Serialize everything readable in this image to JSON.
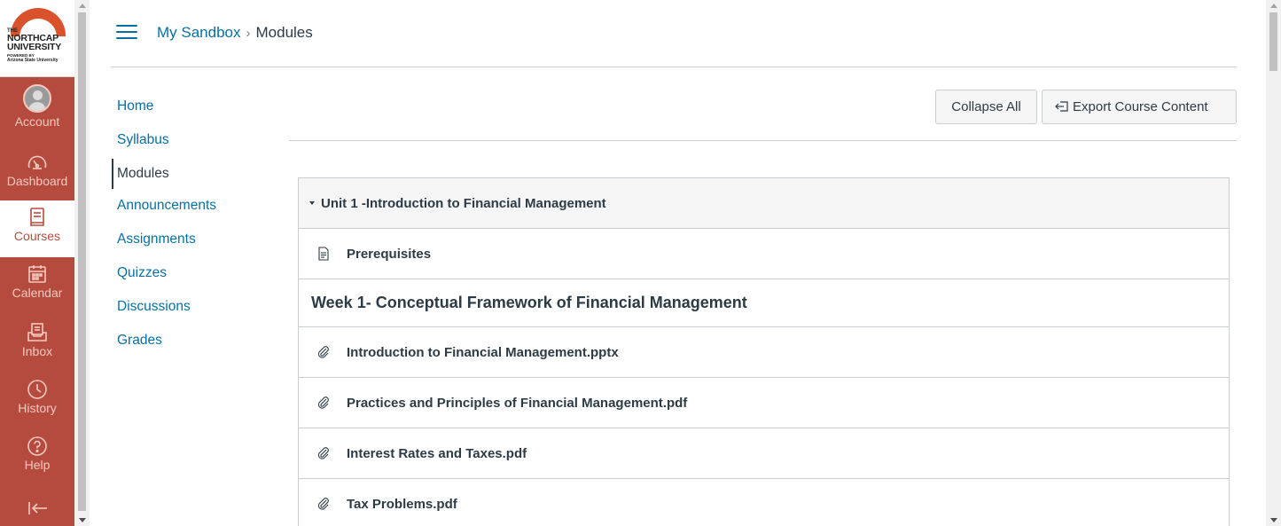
{
  "logo": {
    "line1": "THE",
    "line2": "NORTHCAP",
    "line3": "UNIVERSITY",
    "line4": "POWERED BY",
    "line5": "Arizona State University"
  },
  "global_nav": [
    {
      "label": "Account",
      "icon": "avatar-icon"
    },
    {
      "label": "Dashboard",
      "icon": "dashboard-icon"
    },
    {
      "label": "Courses",
      "icon": "courses-icon"
    },
    {
      "label": "Calendar",
      "icon": "calendar-icon"
    },
    {
      "label": "Inbox",
      "icon": "inbox-icon"
    },
    {
      "label": "History",
      "icon": "clock-icon"
    },
    {
      "label": "Help",
      "icon": "help-icon"
    }
  ],
  "breadcrumb": {
    "course": "My Sandbox",
    "separator": "›",
    "current": "Modules"
  },
  "course_nav": [
    "Home",
    "Syllabus",
    "Modules",
    "Announcements",
    "Assignments",
    "Quizzes",
    "Discussions",
    "Grades"
  ],
  "toolbar": {
    "collapse_label": "Collapse All",
    "export_label": "Export Course Content"
  },
  "module": {
    "title": "Unit 1 -Introduction to Financial Management",
    "items": [
      {
        "type": "page",
        "icon": "page-icon",
        "title": "Prerequisites"
      },
      {
        "type": "subheader",
        "title": "Week 1- Conceptual Framework of Financial Management"
      },
      {
        "type": "file",
        "icon": "paperclip-icon",
        "title": "Introduction to Financial Management.pptx"
      },
      {
        "type": "file",
        "icon": "paperclip-icon",
        "title": "Practices and Principles of Financial Management.pdf"
      },
      {
        "type": "file",
        "icon": "paperclip-icon",
        "title": "Interest Rates and Taxes.pdf"
      },
      {
        "type": "file",
        "icon": "paperclip-icon",
        "title": "Tax Problems.pdf"
      }
    ]
  },
  "colors": {
    "nav_bg": "#b54b3e",
    "link": "#0770a3",
    "text": "#2d3b45",
    "border": "#c7cdd1"
  }
}
